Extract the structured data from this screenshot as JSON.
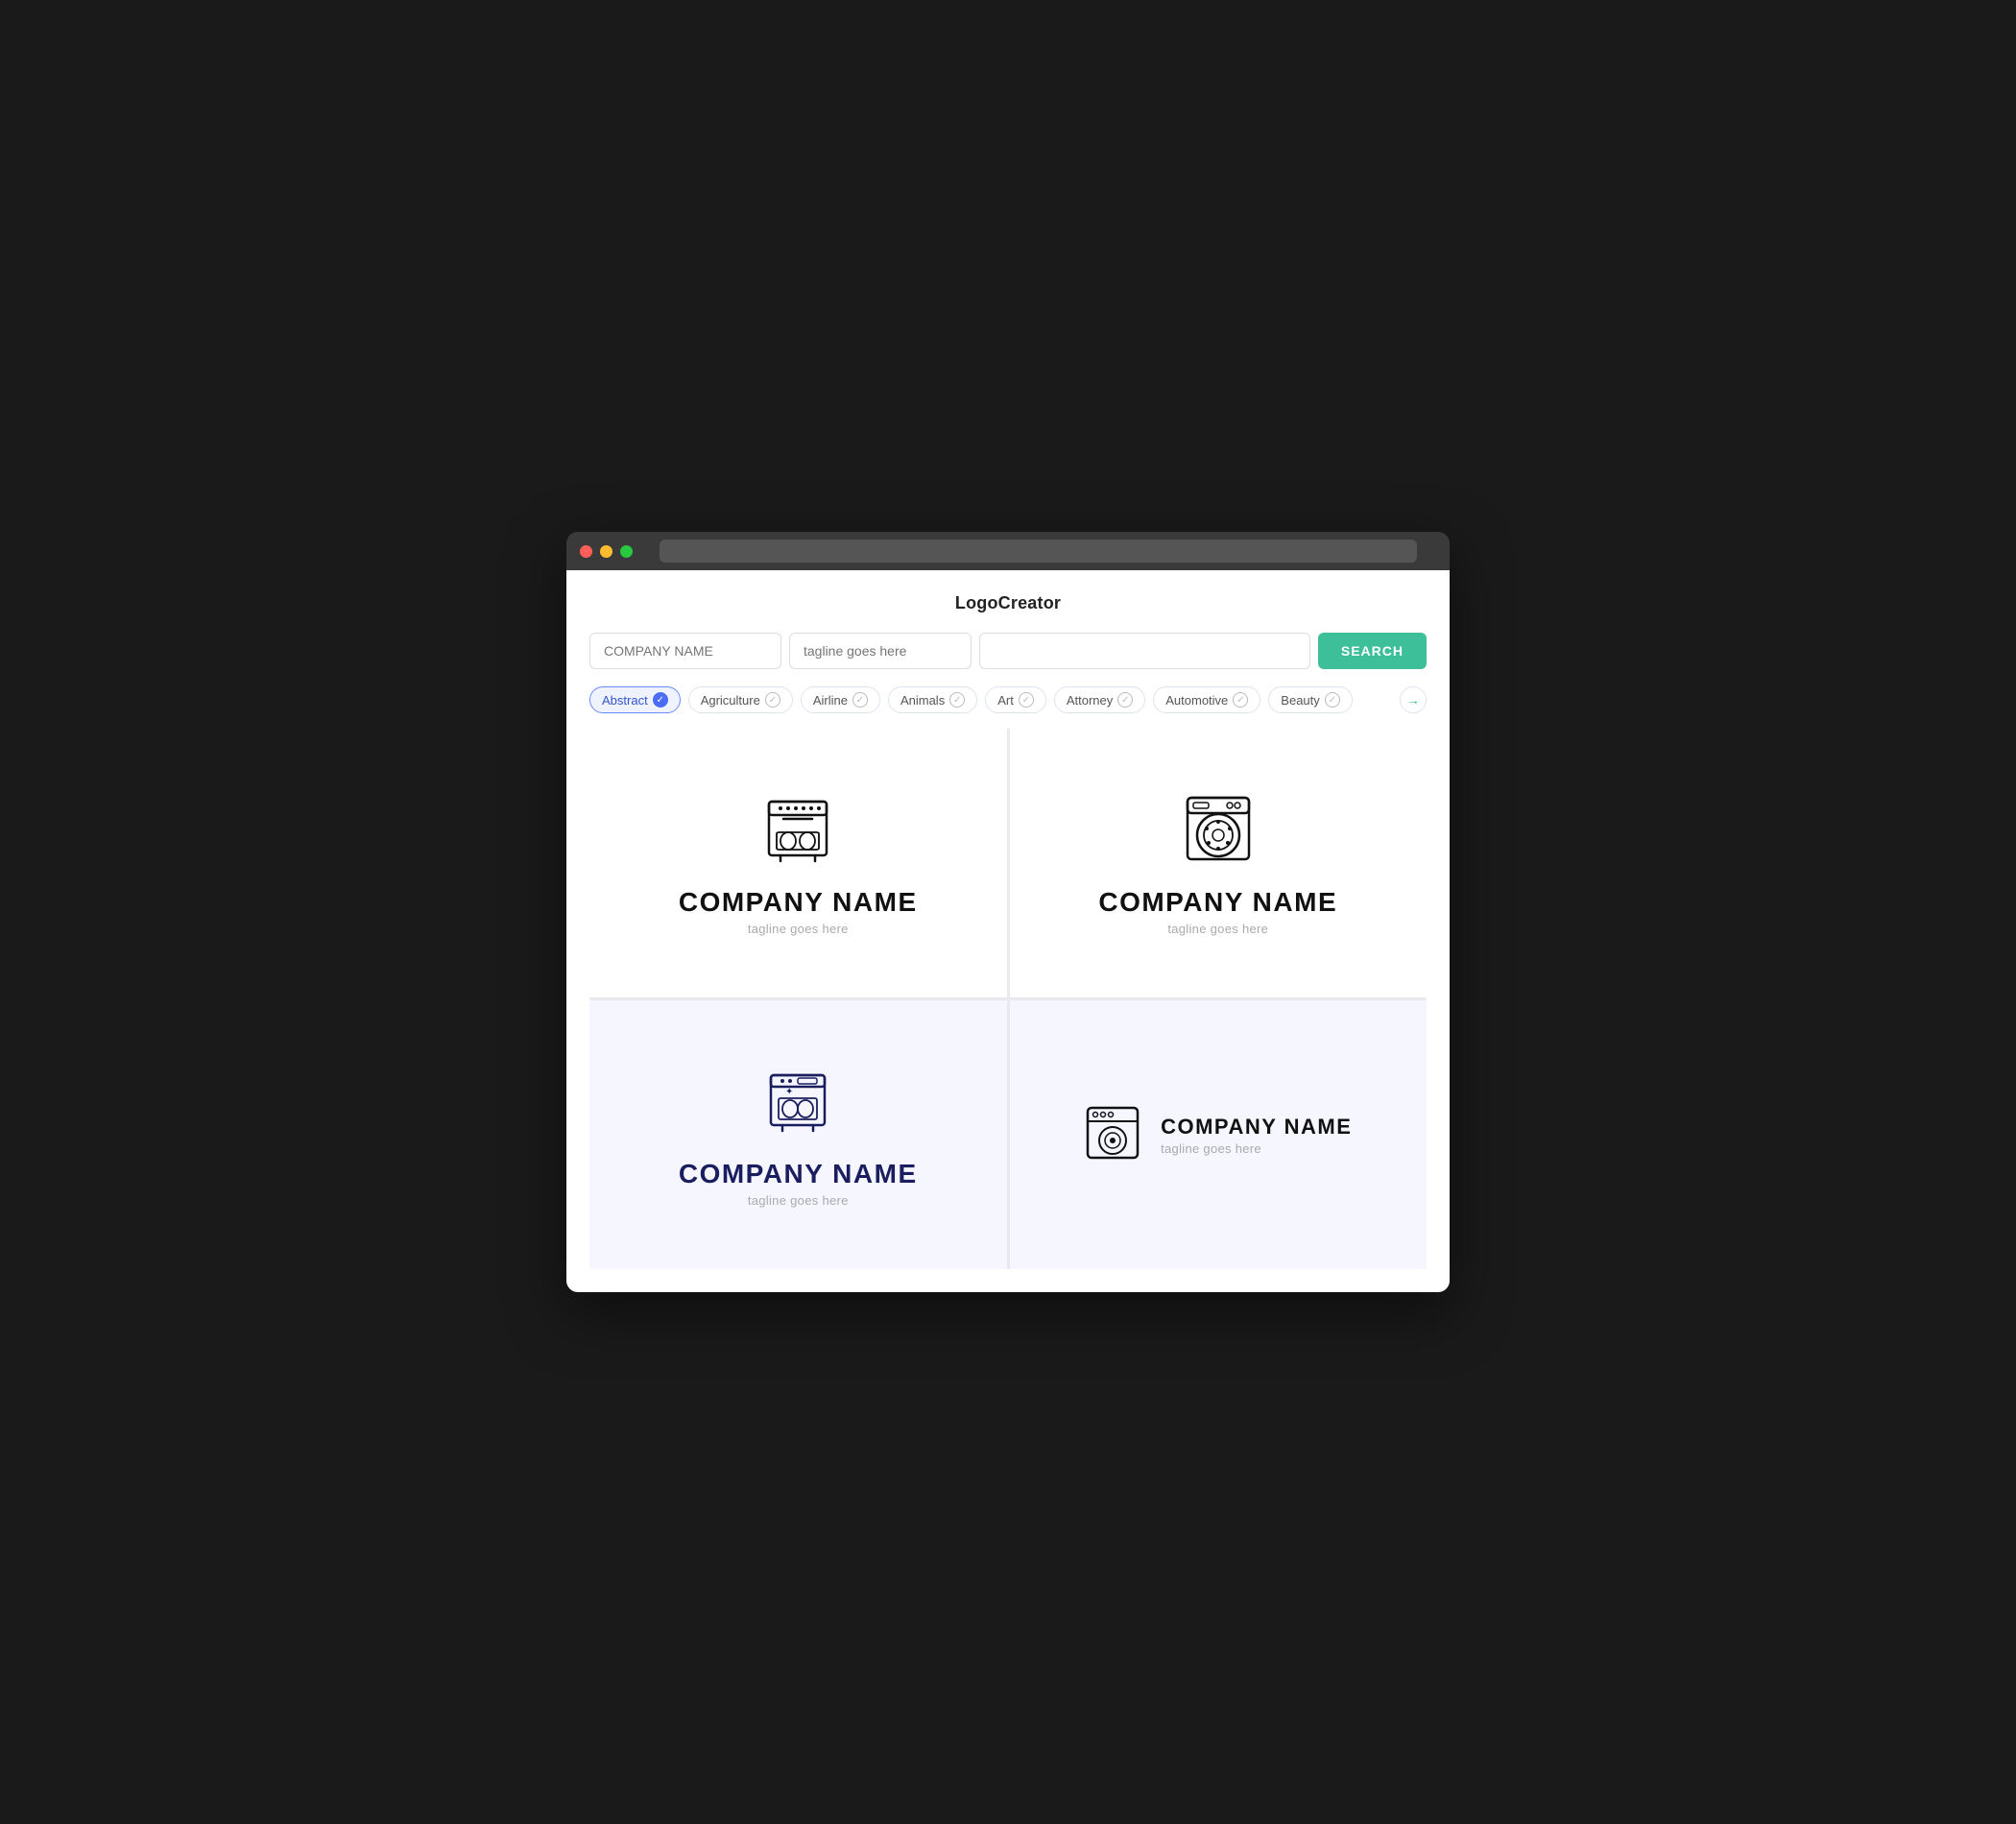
{
  "app": {
    "title": "LogoCreator"
  },
  "browser": {
    "address_bar_placeholder": ""
  },
  "search": {
    "company_placeholder": "COMPANY NAME",
    "tagline_placeholder": "tagline goes here",
    "keyword_placeholder": "",
    "search_button_label": "SEARCH"
  },
  "filters": [
    {
      "id": "abstract",
      "label": "Abstract",
      "active": true
    },
    {
      "id": "agriculture",
      "label": "Agriculture",
      "active": false
    },
    {
      "id": "airline",
      "label": "Airline",
      "active": false
    },
    {
      "id": "animals",
      "label": "Animals",
      "active": false
    },
    {
      "id": "art",
      "label": "Art",
      "active": false
    },
    {
      "id": "attorney",
      "label": "Attorney",
      "active": false
    },
    {
      "id": "automotive",
      "label": "Automotive",
      "active": false
    },
    {
      "id": "beauty",
      "label": "Beauty",
      "active": false
    }
  ],
  "logo_cards": [
    {
      "id": "card1",
      "company": "COMPANY NAME",
      "tagline": "tagline goes here",
      "style": "top-left",
      "color": "black"
    },
    {
      "id": "card2",
      "company": "COMPANY NAME",
      "tagline": "tagline goes here",
      "style": "top-right",
      "color": "black"
    },
    {
      "id": "card3",
      "company": "COMPANY NAME",
      "tagline": "tagline goes here",
      "style": "bottom-left",
      "color": "navy"
    },
    {
      "id": "card4",
      "company": "COMPANY NAME",
      "tagline": "tagline goes here",
      "style": "bottom-right",
      "color": "black"
    }
  ],
  "colors": {
    "search_button": "#3dbf9a",
    "active_filter_bg": "#eef3ff",
    "active_filter_border": "#6b8cff",
    "active_check": "#4a6cf7",
    "arrow_color": "#3dbf9a"
  }
}
